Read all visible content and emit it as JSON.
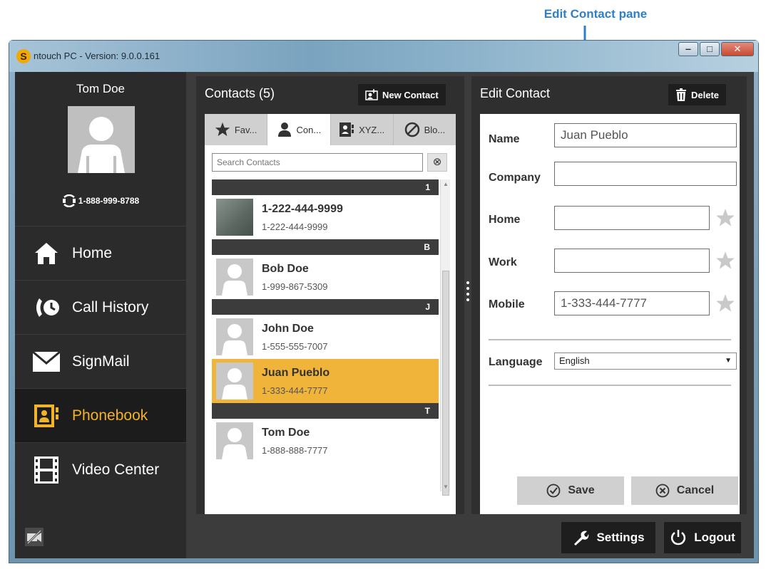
{
  "annotation": {
    "label": "Edit Contact pane"
  },
  "window": {
    "title": "ntouch PC - Version: 9.0.0.161",
    "logo_letter": "S"
  },
  "user": {
    "name": "Tom Doe",
    "phone": "1-888-999-8788"
  },
  "nav": [
    {
      "label": "Home",
      "icon": "home-icon"
    },
    {
      "label": "Call History",
      "icon": "call-history-icon"
    },
    {
      "label": "SignMail",
      "icon": "envelope-icon"
    },
    {
      "label": "Phonebook",
      "icon": "phonebook-icon",
      "active": true
    },
    {
      "label": "Video Center",
      "icon": "film-icon"
    }
  ],
  "contacts": {
    "title": "Contacts (5)",
    "new_contact_label": "New Contact",
    "tabs": [
      {
        "label": "Fav...",
        "icon": "star-icon"
      },
      {
        "label": "Con...",
        "icon": "person-icon",
        "active": true
      },
      {
        "label": "XYZ...",
        "icon": "phonebook-icon"
      },
      {
        "label": "Blo...",
        "icon": "block-icon"
      }
    ],
    "search_placeholder": "Search Contacts",
    "sections": [
      {
        "letter": "1",
        "entries": [
          {
            "name": "1-222-444-9999",
            "phone": "1-222-444-9999",
            "photo": true
          }
        ]
      },
      {
        "letter": "B",
        "entries": [
          {
            "name": "Bob Doe",
            "phone": "1-999-867-5309"
          }
        ]
      },
      {
        "letter": "J",
        "entries": [
          {
            "name": "John Doe",
            "phone": "1-555-555-7007"
          },
          {
            "name": "Juan Pueblo",
            "phone": "1-333-444-7777",
            "selected": true
          }
        ]
      },
      {
        "letter": "T",
        "entries": [
          {
            "name": "Tom Doe",
            "phone": "1-888-888-7777"
          }
        ]
      }
    ]
  },
  "edit_contact": {
    "title": "Edit Contact",
    "delete_label": "Delete",
    "labels": {
      "name": "Name",
      "company": "Company",
      "home": "Home",
      "work": "Work",
      "mobile": "Mobile",
      "language": "Language"
    },
    "values": {
      "name": "Juan Pueblo",
      "company": "",
      "home": "",
      "work": "",
      "mobile": "1-333-444-7777",
      "language": "English"
    },
    "save_label": "Save",
    "cancel_label": "Cancel"
  },
  "bottom": {
    "settings_label": "Settings",
    "logout_label": "Logout"
  },
  "colors": {
    "accent": "#f0b43a",
    "annotation": "#2f7fc4",
    "panel": "#2f2f2f",
    "sidebar": "#2b2b2b"
  }
}
